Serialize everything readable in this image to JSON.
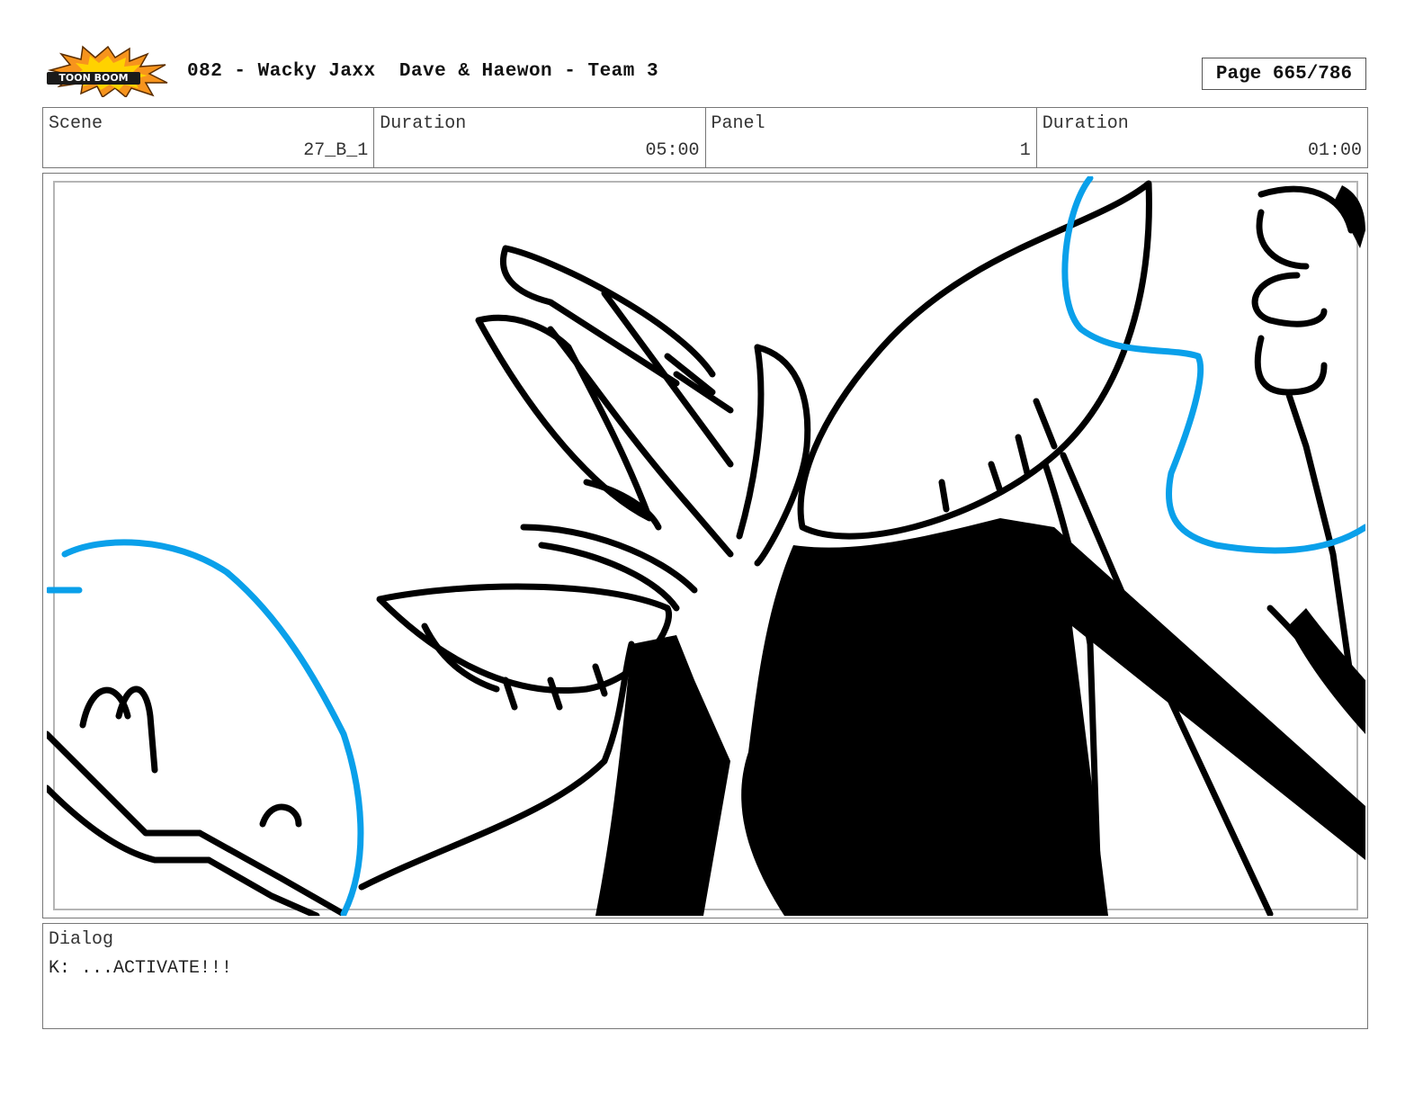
{
  "header": {
    "logo_text": "TOON BOOM",
    "title": "082 - Wacky Jaxx  Dave & Haewon - Team 3",
    "page_label": "Page 665/786"
  },
  "info": {
    "scene_label": "Scene",
    "scene_value": "27_B_1",
    "duration_label": "Duration",
    "duration_value": "05:00",
    "panel_label": "Panel",
    "panel_value": "1",
    "panel_duration_label": "Duration",
    "panel_duration_value": "01:00"
  },
  "dialog": {
    "label": "Dialog",
    "text": "K: ...ACTIVATE!!!"
  },
  "colors": {
    "ink": "#000000",
    "guide_blue": "#0aa0ea",
    "logo_orange": "#f7941d",
    "logo_yellow": "#ffd200"
  }
}
